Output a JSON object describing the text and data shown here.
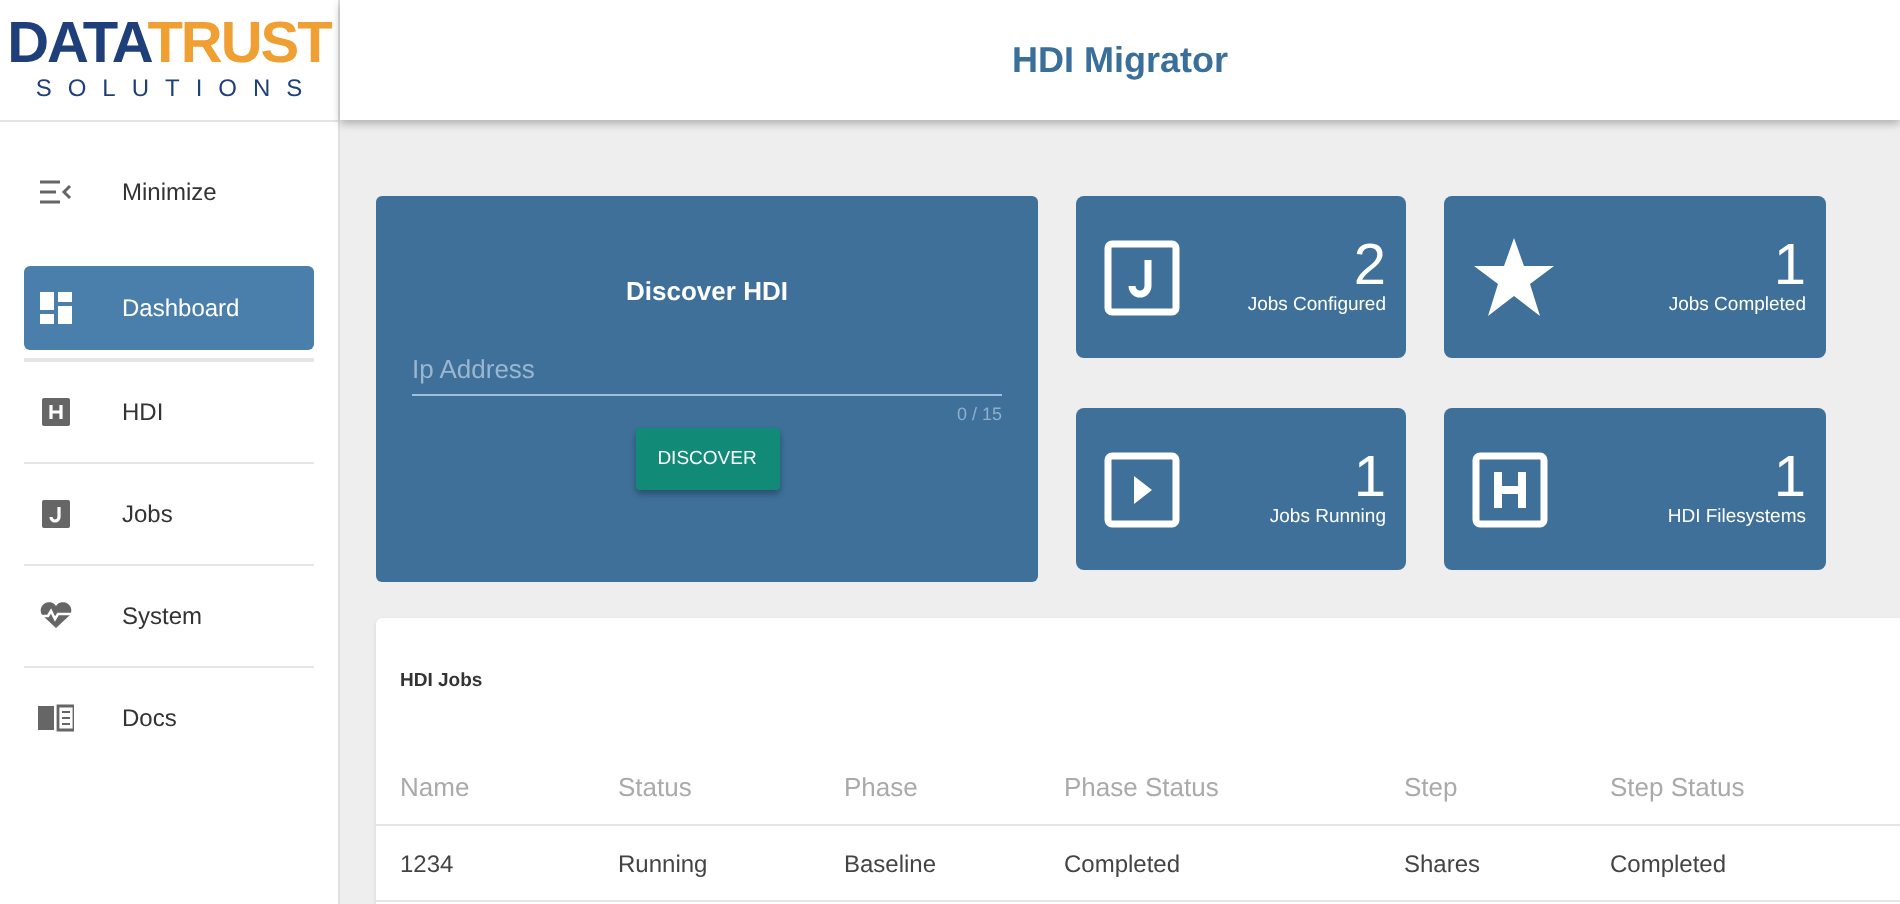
{
  "logo": {
    "primary": "DATA",
    "secondary": "TRUST",
    "tagline": "SOLUTIONS"
  },
  "header": {
    "title": "HDI Migrator"
  },
  "sidebar": {
    "items": [
      {
        "label": "Minimize",
        "selected": false
      },
      {
        "label": "Dashboard",
        "selected": true
      },
      {
        "label": "HDI",
        "selected": false
      },
      {
        "label": "Jobs",
        "selected": false
      },
      {
        "label": "System",
        "selected": false
      },
      {
        "label": "Docs",
        "selected": false
      }
    ]
  },
  "discover": {
    "title": "Discover HDI",
    "placeholder": "Ip Address",
    "counter": "0 / 15",
    "button": "DISCOVER"
  },
  "stats": [
    {
      "value": "2",
      "label": "Jobs Configured"
    },
    {
      "value": "1",
      "label": "Jobs Completed"
    },
    {
      "value": "1",
      "label": "Jobs Running"
    },
    {
      "value": "1",
      "label": "HDI Filesystems"
    }
  ],
  "table": {
    "title": "HDI Jobs",
    "columns": [
      "Name",
      "Status",
      "Phase",
      "Phase Status",
      "Step",
      "Step Status"
    ],
    "rows": [
      [
        "1234",
        "Running",
        "Baseline",
        "Completed",
        "Shares",
        "Completed"
      ]
    ]
  }
}
